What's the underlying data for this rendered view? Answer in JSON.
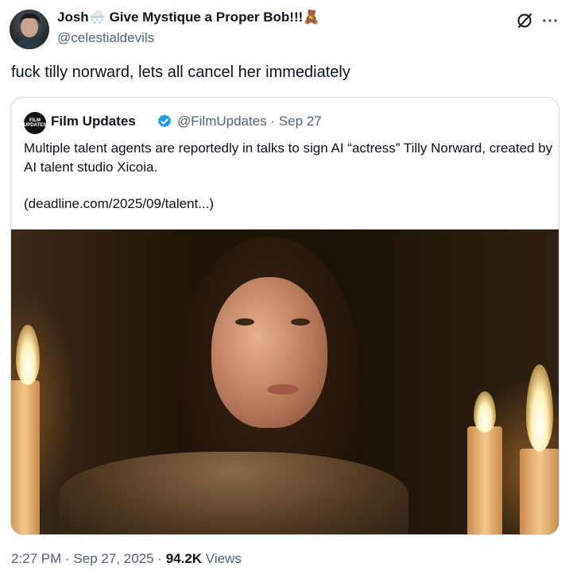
{
  "author": {
    "display_name": "Josh🌨️ Give Mystique a Proper Bob!!!🧸",
    "handle": "@celestialdevils",
    "avatar_icon": "avatar"
  },
  "tweet": {
    "text": "fuck tilly norward, lets all cancel her immediately"
  },
  "quoted_tweet": {
    "author_name": "Film Updates",
    "avatar_text": "FILM UPDATES",
    "verified_color": "#1d9bf0",
    "handle": "@FilmUpdates",
    "date": "Sep 27",
    "meta": "@FilmUpdates · Sep 27",
    "body": "Multiple talent agents are reportedly in talks to sign AI “actress” Tilly Norward, created by AI talent studio Xicoia.",
    "link": "(deadline.com/2025/09/talent...)",
    "media_icon": "photo-of-woman-by-candlelight"
  },
  "footer": {
    "time": "2:27 PM",
    "date": "Sep 27, 2025",
    "views_count": "94.2K",
    "views_label": "Views",
    "sep": " · "
  },
  "colors": {
    "primary_text": "#0f1419",
    "secondary_text": "#536471",
    "border": "#cfd9de",
    "verified": "#1d9bf0"
  }
}
